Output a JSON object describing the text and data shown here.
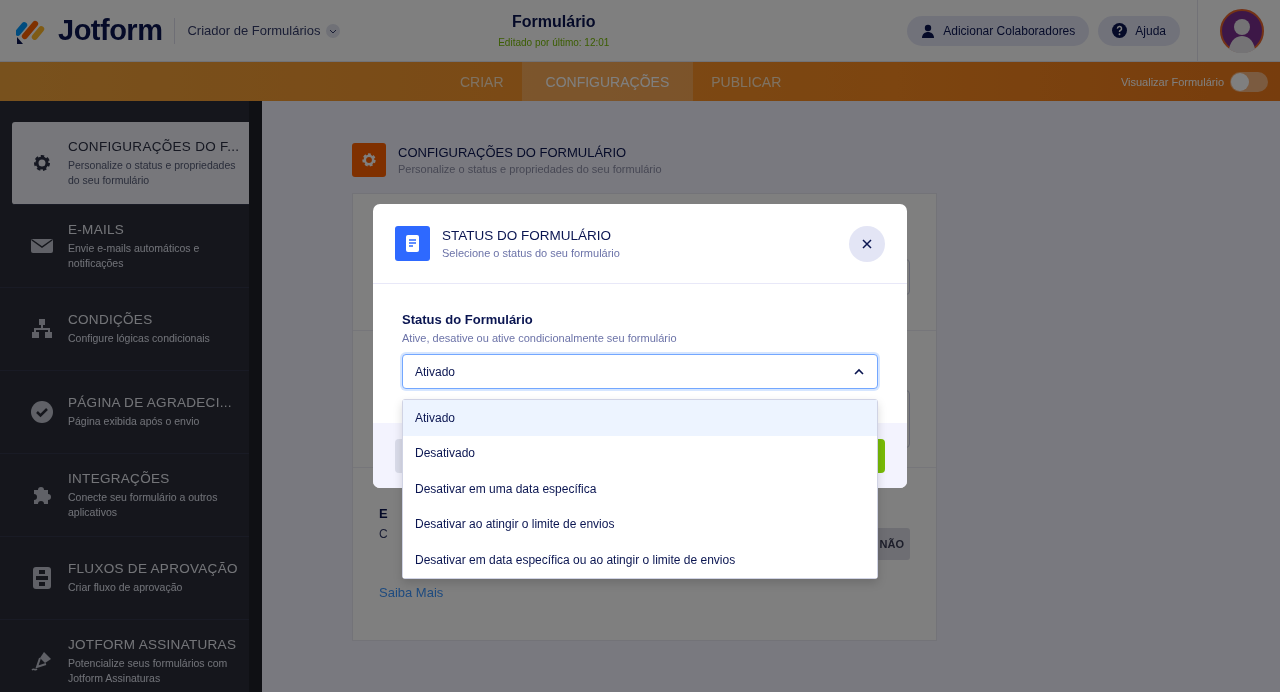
{
  "header": {
    "logo": "Jotform",
    "app_switcher": "Criador de Formulários",
    "title": "Formulário",
    "subtitle": "Editado por último: 12:01",
    "buttons": [
      {
        "label": "Adicionar Colaboradores",
        "kind": "user"
      },
      {
        "label": "Ajuda",
        "kind": "help"
      }
    ]
  },
  "nav": {
    "tabs": [
      {
        "label": "CRIAR",
        "selected": false
      },
      {
        "label": "CONFIGURAÇÕES",
        "selected": true
      },
      {
        "label": "PUBLICAR",
        "selected": false
      }
    ],
    "preview": {
      "label": "Visualizar Formulário",
      "on": false
    }
  },
  "sidebar": {
    "items": [
      {
        "title": "CONFIGURAÇÕES DO F...",
        "description": "Personalize o status e propriedades do seu formulário",
        "kind": "gear",
        "selected": true
      },
      {
        "title": "E-MAILS",
        "description": "Envie e-mails automáticos e notificações",
        "kind": "mail",
        "selected": false
      },
      {
        "title": "CONDIÇÕES",
        "description": "Configure lógicas condicionais",
        "kind": "tree",
        "selected": false
      },
      {
        "title": "PÁGINA DE AGRADECI...",
        "description": "Página exibida após o envio",
        "kind": "check",
        "selected": false
      },
      {
        "title": "INTEGRAÇÕES",
        "description": "Conecte seu formulário a outros aplicativos",
        "kind": "puzzle",
        "selected": false
      },
      {
        "title": "FLUXOS DE APROVAÇÃO",
        "description": "Criar fluxo de aprovação",
        "kind": "flow",
        "selected": false
      },
      {
        "title": "JOTFORM ASSINATURAS",
        "description": "Potencialize seus formulários com Jotform Assinaturas",
        "kind": "pen",
        "selected": false
      }
    ]
  },
  "section": {
    "title": "CONFIGURAÇÕES DO FORMULÁRIO",
    "subtitle": "Personalize o status e propriedades do seu formulário"
  },
  "card": {
    "heading": "E",
    "text": "C",
    "link": "Saiba Mais",
    "toggle_label": "NÃO"
  },
  "modal": {
    "title": "STATUS DO FORMULÁRIO",
    "subtitle": "Selecione o status do seu formulário",
    "field_label": "Status do Formulário",
    "field_hint": "Ative, desative ou ative condicionalmente seu formulário",
    "value": "Ativado",
    "options": [
      {
        "label": "Ativado",
        "selected": true
      },
      {
        "label": "Desativado",
        "selected": false
      },
      {
        "label": "Desativar em uma data específica",
        "selected": false
      },
      {
        "label": "Desativar ao atingir o limite de envios",
        "selected": false
      },
      {
        "label": "Desativar em data específica ou ao atingir o limite de envios",
        "selected": false
      }
    ]
  }
}
